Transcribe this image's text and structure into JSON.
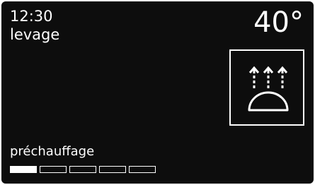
{
  "display": {
    "time": "12:30",
    "mode": "levage",
    "temperature": "40°",
    "program_icon": "proofing-dome-rising-heat-icon",
    "status": "préchauffage",
    "progress": {
      "segments_total": 5,
      "segments_filled": 1,
      "fraction": 0.2
    }
  },
  "colors": {
    "screen_background": "#0d0d0d",
    "foreground": "#ffffff",
    "bezel": "#ffffff"
  }
}
